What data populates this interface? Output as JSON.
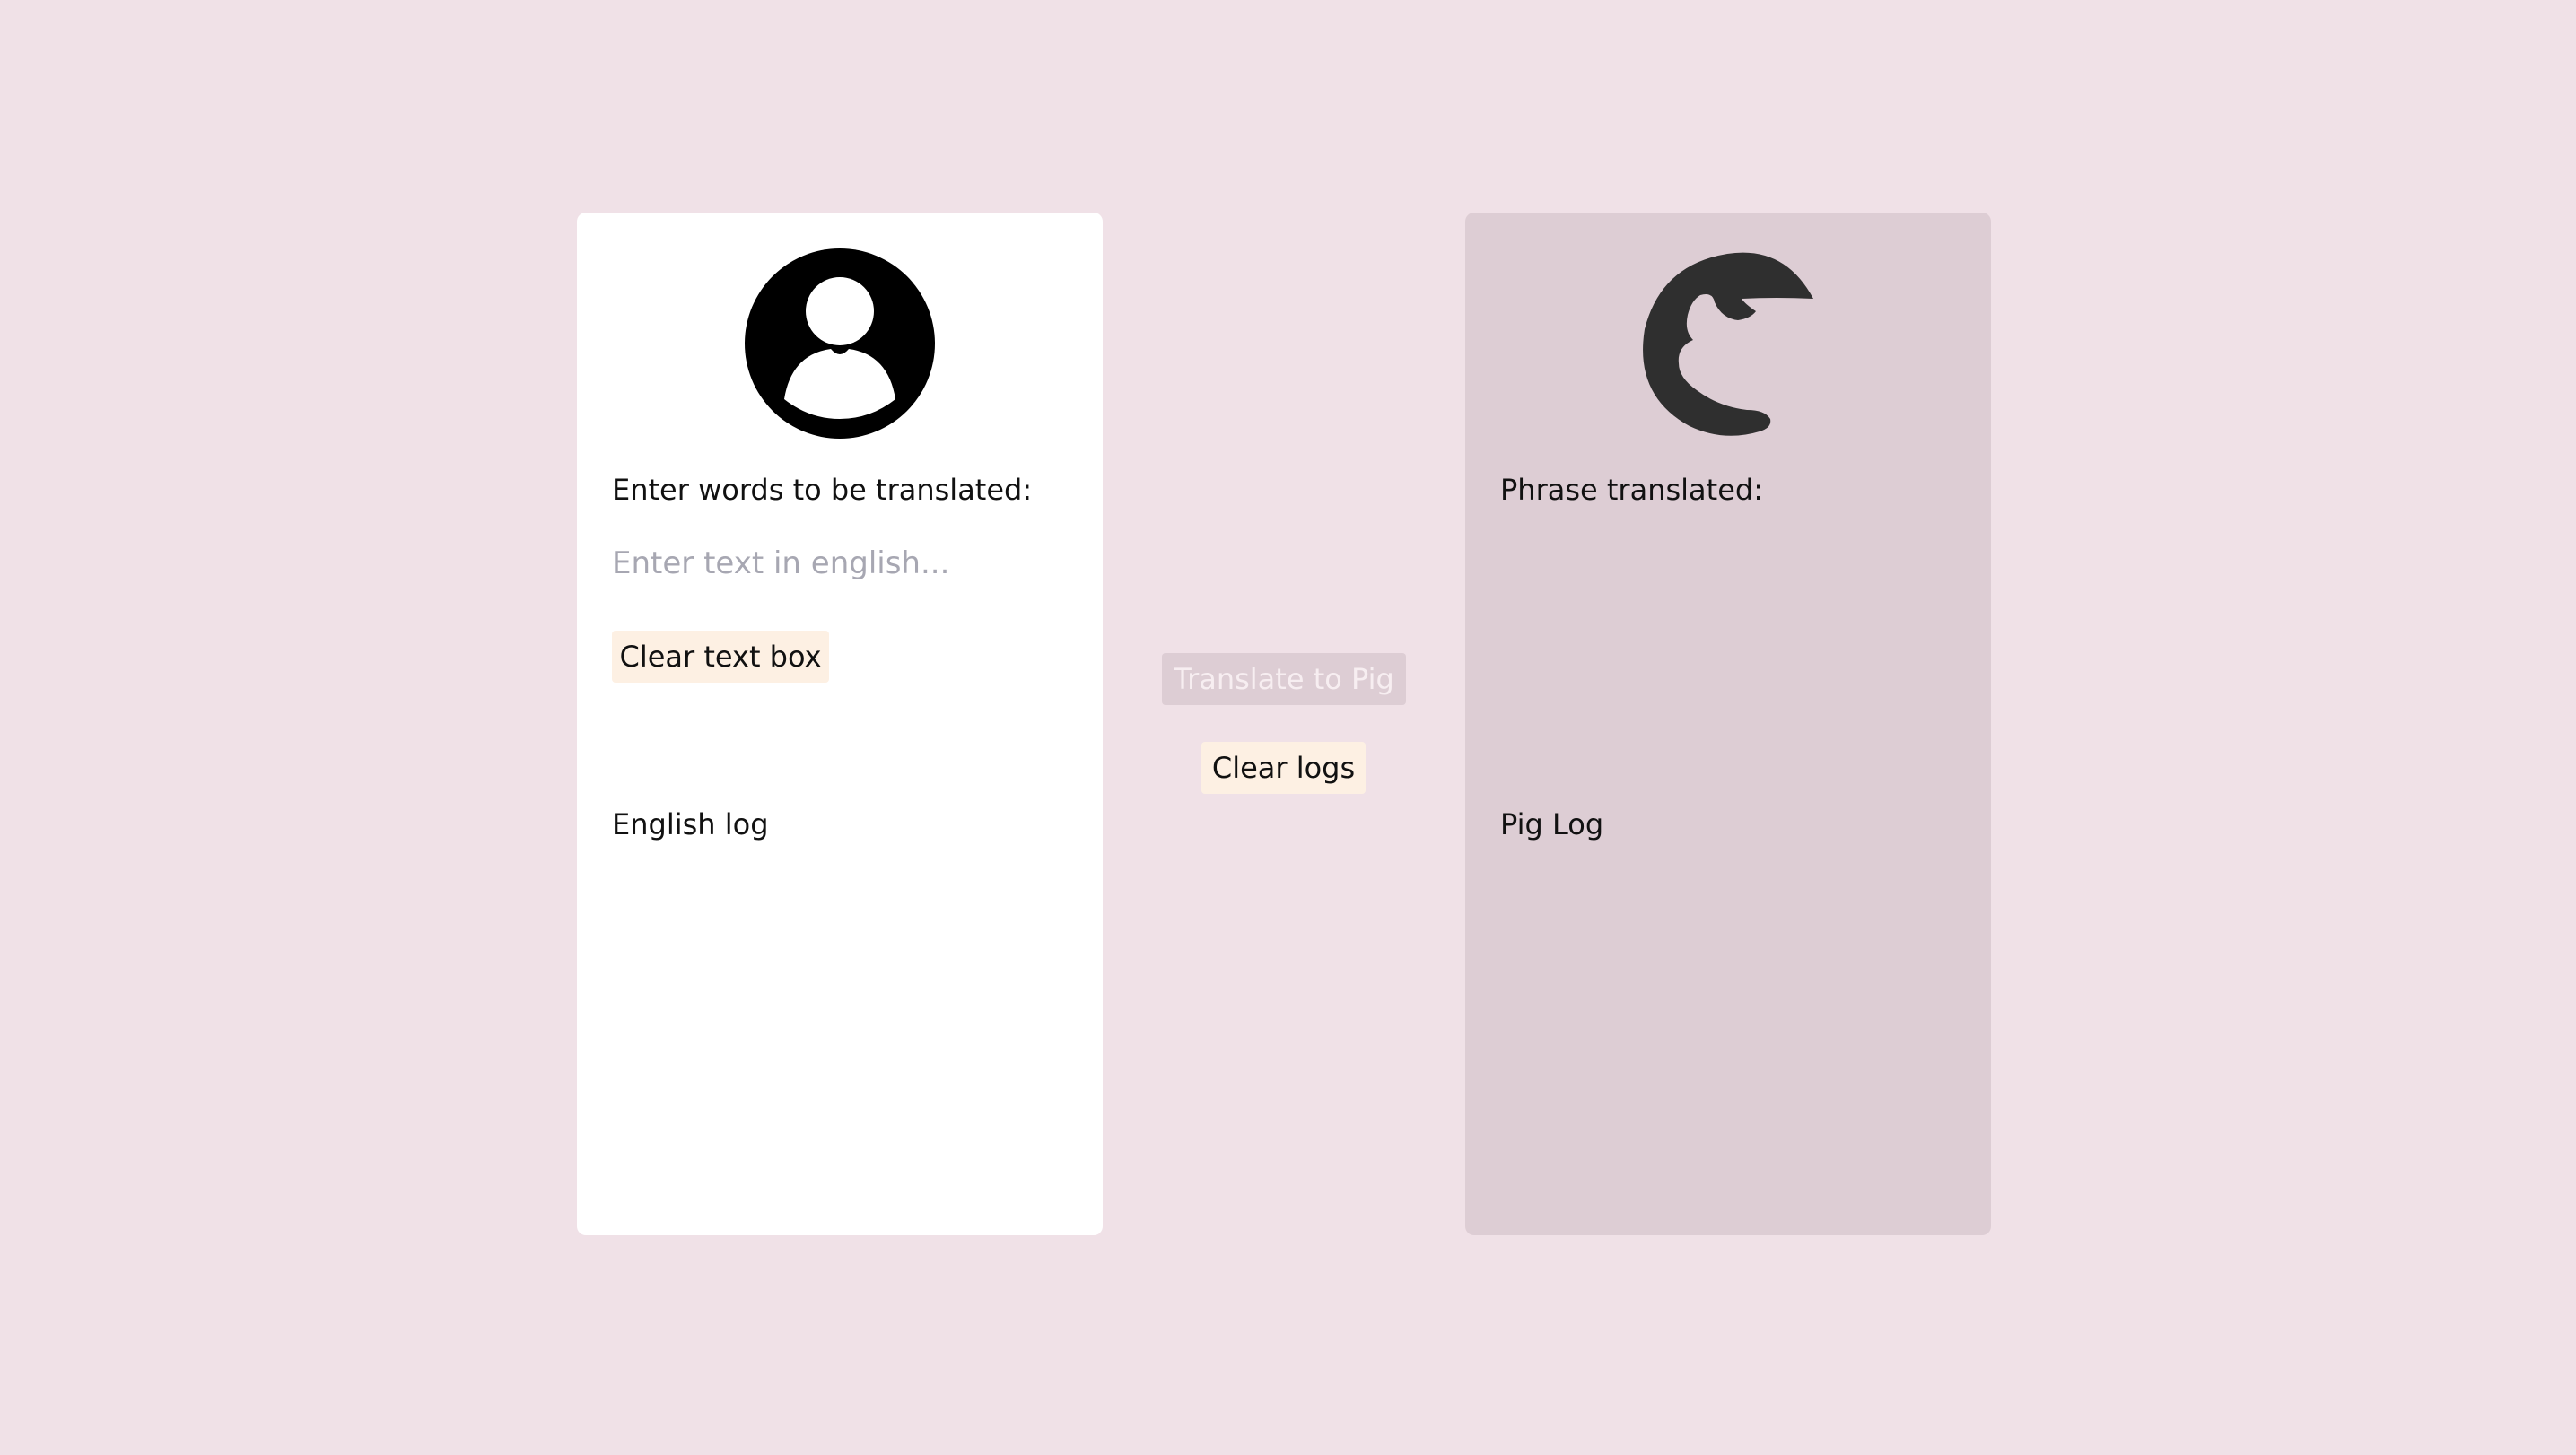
{
  "english_panel": {
    "avatar_icon": "user-circle-icon",
    "prompt_label": "Enter words to be translated:",
    "input": {
      "value": "",
      "placeholder": "Enter text in english..."
    },
    "clear_button_label": "Clear text box",
    "log_title": "English log",
    "log_entries": []
  },
  "center_controls": {
    "translate_button_label": "Translate to Pig",
    "translate_button_disabled": true,
    "clear_logs_button_label": "Clear logs"
  },
  "pig_panel": {
    "avatar_icon": "pig-head-icon",
    "output_label": "Phrase translated:",
    "translated_phrase": "",
    "log_title": "Pig Log",
    "log_entries": []
  },
  "colors": {
    "page_background": "#f0e1e7",
    "english_panel_background": "#ffffff",
    "pig_panel_background": "#ddcdd4",
    "button_accent": "#fdf0e3"
  }
}
